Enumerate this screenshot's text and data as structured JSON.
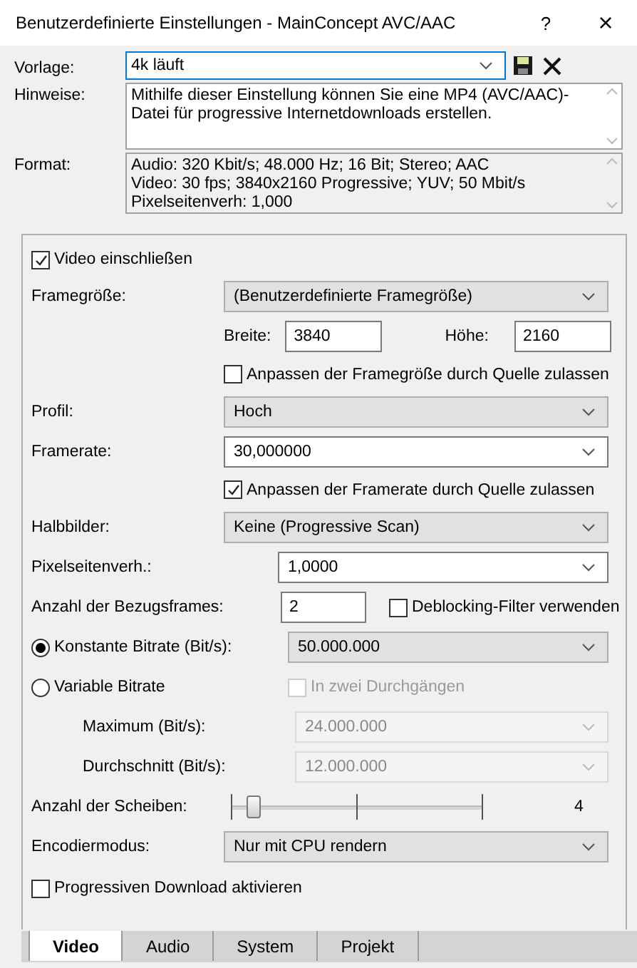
{
  "window": {
    "title": "Benutzerdefinierte Einstellungen - MainConcept AVC/AAC",
    "help": "?",
    "close": "×"
  },
  "template": {
    "label": "Vorlage:",
    "value": "4k läuft"
  },
  "notes": {
    "label": "Hinweise:",
    "lines": [
      "Mithilfe dieser Einstellung können Sie eine MP4 (AVC/AAC)-",
      "Datei für progressive Internetdownloads erstellen."
    ]
  },
  "format": {
    "label": "Format:",
    "lines": [
      "Audio: 320 Kbit/s; 48.000 Hz; 16 Bit; Stereo; AAC",
      "Video: 30 fps; 3840x2160 Progressive; YUV; 50 Mbit/s",
      "Pixelseitenverh: 1,000"
    ]
  },
  "video": {
    "include": {
      "label": "Video einschließen",
      "checked": true
    },
    "rows": [
      {
        "kind": "select",
        "label": "Framegröße:",
        "value": "(Benutzerdefinierte Framegröße)",
        "editable": false
      },
      {
        "kind": "size",
        "width_label": "Breite:",
        "width_value": "3840",
        "height_label": "Höhe:",
        "height_value": "2160"
      },
      {
        "kind": "check",
        "label": "Anpassen der Framegröße durch Quelle zulassen",
        "checked": false
      },
      {
        "kind": "select",
        "label": "Profil:",
        "value": "Hoch",
        "editable": false
      },
      {
        "kind": "select",
        "label": "Framerate:",
        "value": "30,000000",
        "editable": true
      },
      {
        "kind": "check",
        "label": "Anpassen der Framerate durch Quelle zulassen",
        "checked": true
      },
      {
        "kind": "select",
        "label": "Halbbilder:",
        "value": "Keine (Progressive Scan)",
        "editable": false
      },
      {
        "kind": "combo",
        "label": "Pixelseitenverh.:",
        "value": "1,0000"
      },
      {
        "kind": "number",
        "label": "Anzahl der Bezugsframes:",
        "value": "2",
        "check_label": "Deblocking-Filter verwenden",
        "checked": false
      },
      {
        "kind": "radio",
        "label": "Konstante Bitrate (Bit/s):",
        "selected": true,
        "value": "50.000.000"
      },
      {
        "kind": "radio-check",
        "label": "Variable Bitrate",
        "selected": false,
        "check_label": "In zwei Durchgängen",
        "checked": false,
        "disabled": true
      },
      {
        "kind": "sub",
        "label": "Maximum (Bit/s):",
        "value": "24.000.000",
        "disabled": true
      },
      {
        "kind": "sub",
        "label": "Durchschnitt (Bit/s):",
        "value": "12.000.000",
        "disabled": true
      },
      {
        "kind": "slider",
        "label": "Anzahl der Scheiben:",
        "level": 0.09,
        "reading": "4"
      },
      {
        "kind": "select",
        "label": "Encodiermodus:",
        "value": "Nur mit CPU rendern",
        "editable": false
      },
      {
        "kind": "option",
        "label": "Progressiven Download aktivieren",
        "checked": false
      }
    ]
  },
  "tabs": [
    {
      "label": "Video",
      "selected": true
    },
    {
      "label": "Audio",
      "selected": false
    },
    {
      "label": "System",
      "selected": false
    },
    {
      "label": "Projekt",
      "selected": false
    }
  ]
}
